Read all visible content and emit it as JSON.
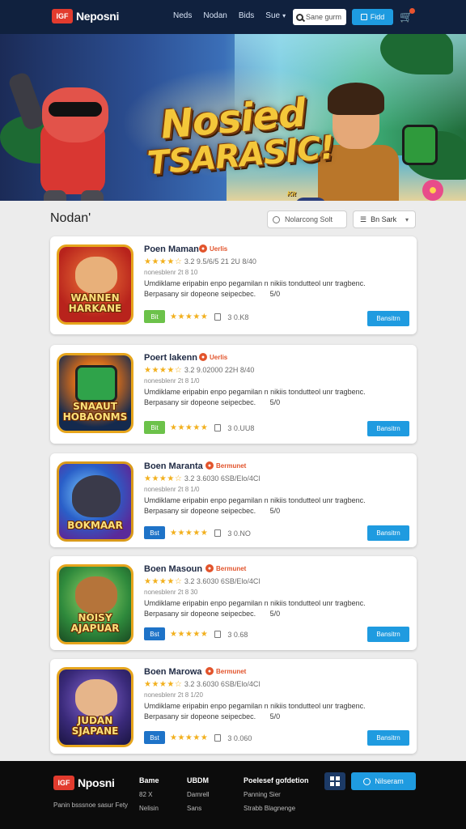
{
  "header": {
    "logo_badge": "IGF",
    "logo_text": "Neposni",
    "nav": [
      "Neds",
      "Nodan",
      "Bids",
      "Sue"
    ],
    "search_placeholder": "Sane gurm",
    "action_label": "Fidd"
  },
  "hero": {
    "title_line1": "Nosied",
    "title_line2": "TSARASIC!",
    "subtitle": "Kit"
  },
  "section": {
    "title": "Nodan'",
    "sort_placeholder": "Nolarcong Solt",
    "filter_label": "Bn Sark"
  },
  "cards": [
    {
      "title": "Poen Maman",
      "tag": "Uerlis",
      "rating_line": "3.2 9.5/6/5 21 2U 8/40",
      "meta": "nonesblenr 2t 8 10",
      "desc1": "Umdiklame eripabin enpo pegamilan n nikiis tondutteol unr tragbenc.",
      "desc2": "Berpasany sir dopeone seipecbec.",
      "desc_num": "5/0",
      "thumb_caption": "WANNEN HARKANE",
      "badge": "Bit",
      "badge_color": "#6cc24a",
      "count": "3 0.K8",
      "button": "Bansitrn"
    },
    {
      "title": "Poert lakenn",
      "tag": "Uerlis",
      "rating_line": "3.2 9.02000 22H 8/40",
      "meta": "nonesblenr 2t 8 1/0",
      "desc1": "Umdiklame eripabin enpo pegamilan n nikiis tondutteol unr tragbenc.",
      "desc2": "Berpasany sir dopeone seipecbec.",
      "desc_num": "5/0",
      "thumb_caption": "SNAAUT HOBAONMS",
      "badge": "Bit",
      "badge_color": "#6cc24a",
      "count": "3 0.UU8",
      "button": "Bansitrn"
    },
    {
      "title": "Boen Maranta",
      "tag": "Bermunet",
      "rating_line": "3.2 3.6030 6SB/Elo/4Cl",
      "meta": "nonesblenr 2t 8 1/0",
      "desc1": "Umdiklame eripabin enpo pegamilan n nikiis tondutteol unr tragbenc.",
      "desc2": "Berpasany sir dopeone seipecbec.",
      "desc_num": "5/0",
      "thumb_caption": "BOKMAAR",
      "badge": "Bst",
      "badge_color": "#1e73c8",
      "count": "3 0.NO",
      "button": "Bansitrn"
    },
    {
      "title": "Boen Masoun",
      "tag": "Bermunet",
      "rating_line": "3.2 3.6030 6SB/Elo/4Cl",
      "meta": "nonesblenr 2t 8 30",
      "desc1": "Umdiklame eripabin enpo pegamilan n nikiis tondutteol unr tragbenc.",
      "desc2": "Berpasany sir dopeone seipecbec.",
      "desc_num": "5/0",
      "thumb_caption": "NOISY AJAPUAR",
      "badge": "Bst",
      "badge_color": "#1e73c8",
      "count": "3 0.68",
      "button": "Bansitrn"
    },
    {
      "title": "Boen Marowa",
      "tag": "Bermunet",
      "rating_line": "3.2 3.6030 6SB/Elo/4Cl",
      "meta": "nonesblenr 2t 8 1/20",
      "desc1": "Umdiklame eripabin enpo pegamilan n nikiis tondutteol unr tragbenc.",
      "desc2": "Berpasany sir dopeone seipecbec.",
      "desc_num": "5/0",
      "thumb_caption": "JUDAN SJAPANE",
      "badge": "Bst",
      "badge_color": "#1e73c8",
      "count": "3 0.060",
      "button": "Bansitrn"
    }
  ],
  "footer": {
    "logo_badge": "IGF",
    "logo_text": "Nposni",
    "tagline": "Panin bsssnoe sasur Fety",
    "col1": {
      "heading": "Bame",
      "items": [
        "82 X",
        "Nelisin"
      ]
    },
    "col2": {
      "heading": "UBDM",
      "items": [
        "Damrell",
        "Sans"
      ]
    },
    "col3": {
      "heading": "Poelesef gofdetion",
      "items": [
        "Panning Sier",
        "Strabb Blagnenge"
      ]
    },
    "button_label": "Nilseram"
  },
  "colors": {
    "header_bg": "#10213e",
    "accent": "#1f9be0",
    "tag": "#e2542c",
    "star": "#f2b01e",
    "footer_bg": "#0c0c0c"
  }
}
